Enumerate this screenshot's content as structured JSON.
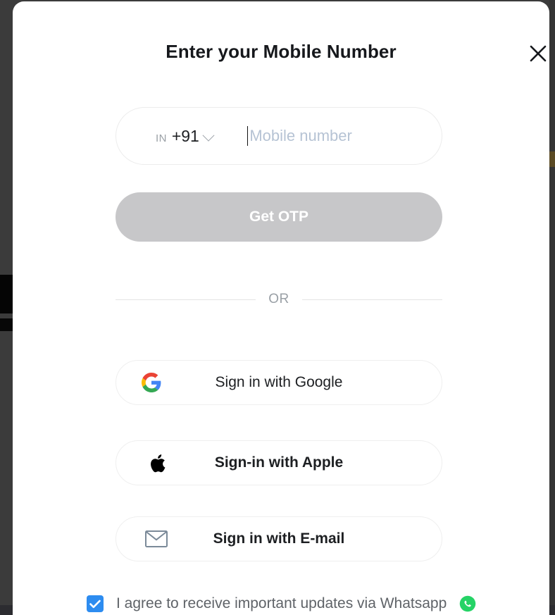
{
  "modal": {
    "title": "Enter your Mobile Number",
    "close_icon": "close-icon"
  },
  "phone_field": {
    "country_iso": "IN",
    "dial_code": "+91",
    "dropdown_icon": "chevron-down-icon",
    "placeholder": "Mobile number",
    "value": "",
    "focused": true
  },
  "primary_action": {
    "label": "Get OTP",
    "disabled": true,
    "bg_color": "#c7c7c9",
    "text_color": "#ffffff"
  },
  "divider": {
    "label": "OR"
  },
  "social_buttons": [
    {
      "id": "google",
      "label": "Sign in with Google",
      "icon": "google-g-icon"
    },
    {
      "id": "apple",
      "label": "Sign-in with Apple",
      "icon": "apple-logo-icon"
    },
    {
      "id": "email",
      "label": "Sign in with E-mail",
      "icon": "envelope-icon"
    }
  ],
  "consent": {
    "label": "I agree to receive important updates via Whatsapp",
    "checked": true,
    "checkbox_color": "#2d8cf0",
    "trailing_icon": "whatsapp-icon"
  }
}
